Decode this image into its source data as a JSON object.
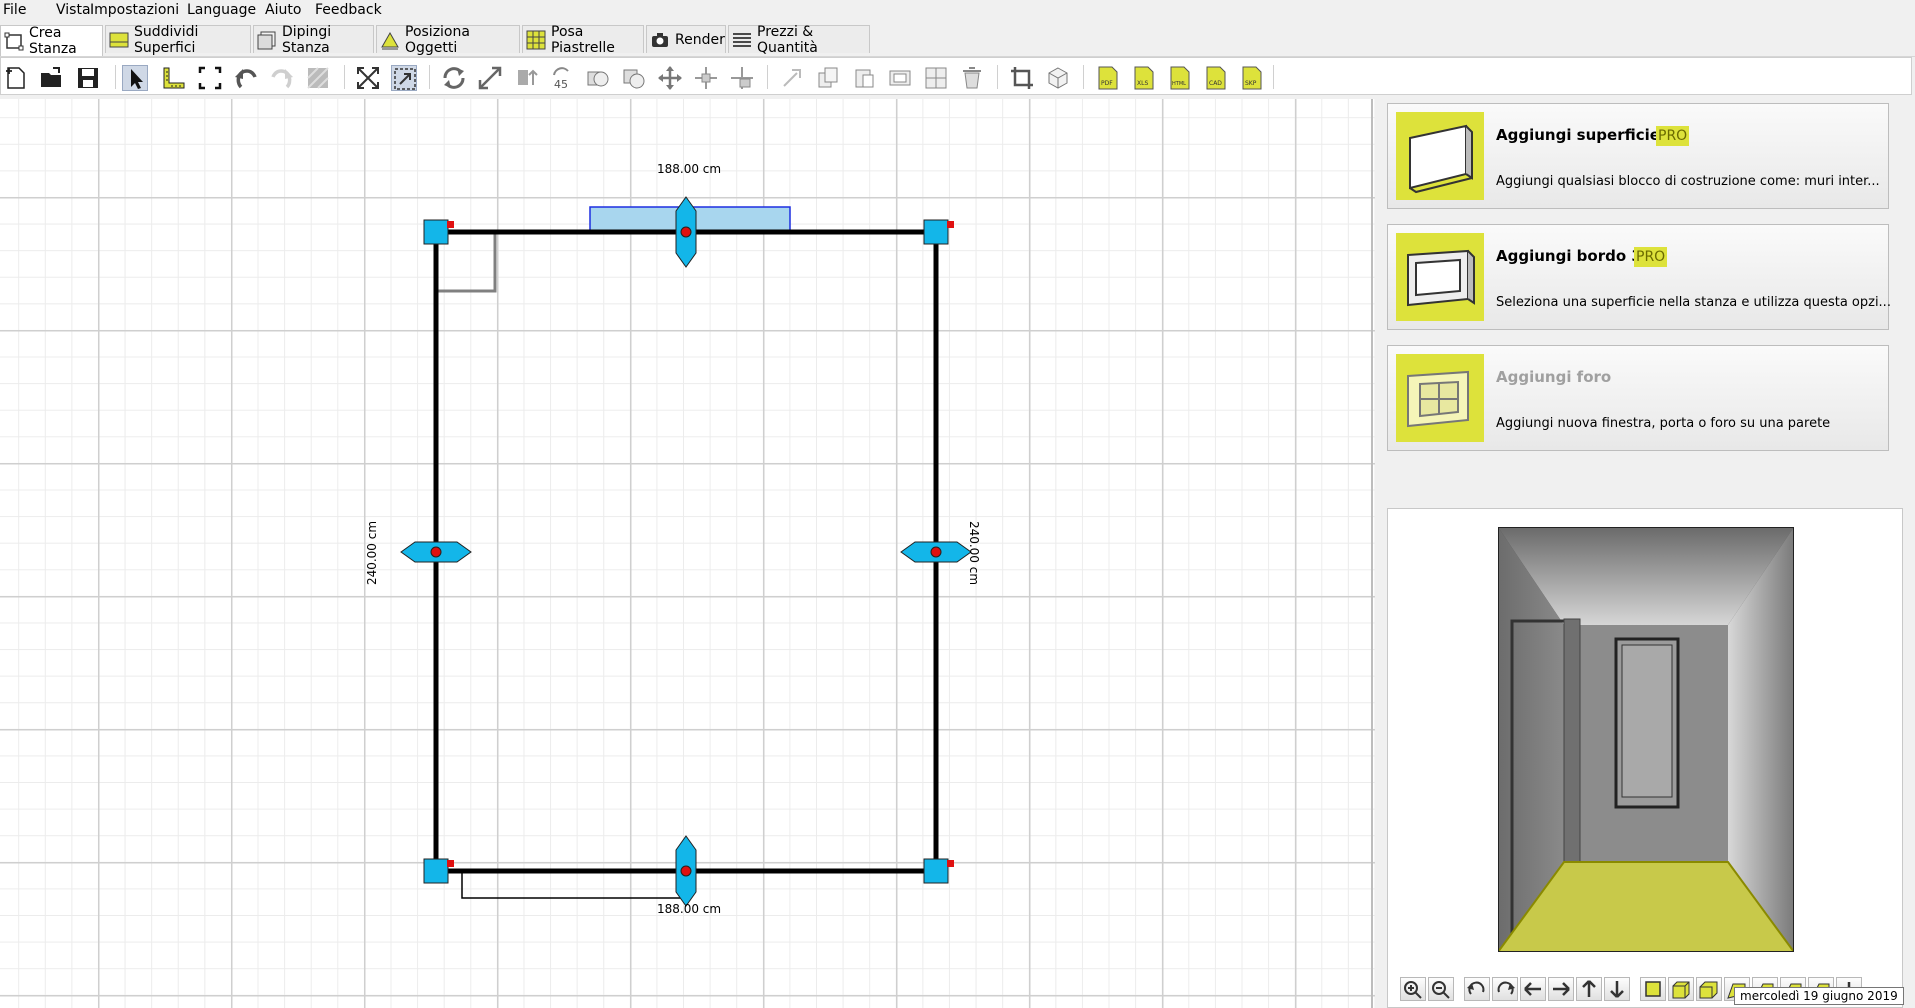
{
  "menu": [
    "File",
    "Vista",
    "Impostazioni",
    "Language",
    "Aiuto",
    "Feedback"
  ],
  "tabs": [
    {
      "label": "Crea Stanza",
      "icon": "create-room-icon"
    },
    {
      "label": "Suddividi Superfici",
      "icon": "split-surface-icon"
    },
    {
      "label": "Dipingi Stanza",
      "icon": "paint-room-icon"
    },
    {
      "label": "Posiziona Oggetti",
      "icon": "place-objects-icon"
    },
    {
      "label": "Posa Piastrelle",
      "icon": "lay-tiles-icon"
    },
    {
      "label": "Render",
      "icon": "camera-icon"
    },
    {
      "label": "Prezzi & Quantità",
      "icon": "list-icon"
    }
  ],
  "toolbar": {
    "file_buttons": [
      "new-file-icon",
      "open-folder-icon",
      "save-icon"
    ],
    "tool_buttons": [
      "select-pointer-icon",
      "measure-ruler-icon",
      "select-area-icon",
      "undo-icon",
      "redo-icon",
      "hatch-icon"
    ],
    "view_buttons": [
      "fit-view-icon",
      "zoom-selection-icon"
    ],
    "edit_buttons": [
      "rotate-icon",
      "resize-icon",
      "mirror-icon",
      "rotate-45-icon",
      "clone-icon",
      "clone-alt-icon",
      "move-icon",
      "move-cross-icon",
      "move-alt-icon"
    ],
    "edit_buttons2": [
      "align-icon",
      "copy-icon",
      "paste-icon",
      "group-icon",
      "grid-icon",
      "delete-icon"
    ],
    "crop_buttons": [
      "crop-icon",
      "box-3d-icon"
    ],
    "export_buttons": [
      {
        "icon": "pdf-export-icon",
        "label": "PDF"
      },
      {
        "icon": "xls-export-icon",
        "label": "XLS"
      },
      {
        "icon": "html-export-icon",
        "label": "HTML"
      },
      {
        "icon": "cad-export-icon",
        "label": "CAD"
      },
      {
        "icon": "skp-export-icon",
        "label": "SKP"
      }
    ]
  },
  "plan": {
    "dim_top": "188.00 cm",
    "dim_bottom": "188.00 cm",
    "dim_left": "240.00 cm",
    "dim_right": "240.00 cm"
  },
  "cards": [
    {
      "title": "Aggiungi superficie 3D",
      "pro": "PRO",
      "desc": "Aggiungi qualsiasi blocco di costruzione come: muri inter...",
      "icon": "surface-3d-icon"
    },
    {
      "title": "Aggiungi bordo 3D",
      "pro": "PRO",
      "desc": "Seleziona una superficie nella stanza e utilizza questa opzi...",
      "icon": "border-3d-icon"
    },
    {
      "title": "Aggiungi foro",
      "pro": "",
      "desc": "Aggiungi nuova finestra, porta o foro su una parete",
      "icon": "add-hole-icon"
    }
  ],
  "view_controls": [
    "zoom-in-icon",
    "zoom-out-icon",
    "rotate-left-icon",
    "rotate-right-icon",
    "arrow-left-icon",
    "arrow-right-icon",
    "arrow-up-icon",
    "arrow-down-icon",
    "view-top-icon",
    "view-box-icon",
    "view-front-icon",
    "view-perspective-icon",
    "view-side-icon",
    "view-iso-icon",
    "view-alt-icon",
    "add-view-icon"
  ],
  "tooltip": "mercoledì 19 giugno 2019",
  "colors": {
    "accent": "#dde23b",
    "handle": "#13b6e9",
    "wall": "#000000",
    "node": "#e01010",
    "door": "#a8d6ee"
  }
}
